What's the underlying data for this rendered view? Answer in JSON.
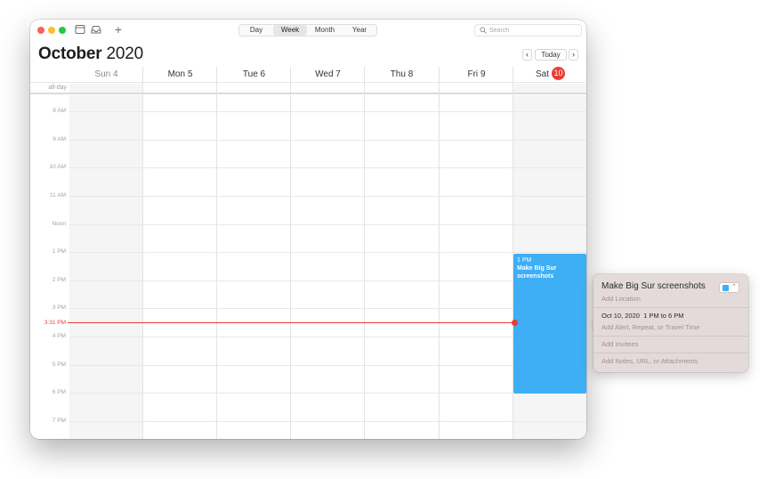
{
  "toolbar": {
    "views": [
      "Day",
      "Week",
      "Month",
      "Year"
    ],
    "selected_view": "Week",
    "search_placeholder": "Search"
  },
  "header": {
    "month": "October",
    "year": "2020",
    "today_label": "Today",
    "prev_label": "‹",
    "next_label": "›"
  },
  "days": [
    {
      "name": "Sun",
      "date": "4"
    },
    {
      "name": "Mon",
      "date": "5"
    },
    {
      "name": "Tue",
      "date": "6"
    },
    {
      "name": "Wed",
      "date": "7"
    },
    {
      "name": "Thu",
      "date": "8"
    },
    {
      "name": "Fri",
      "date": "9"
    },
    {
      "name": "Sat",
      "date": "10"
    }
  ],
  "allday_label": "all-day",
  "time_labels": [
    "8 AM",
    "9 AM",
    "10 AM",
    "11 AM",
    "Noon",
    "1 PM",
    "2 PM",
    "3 PM",
    "4 PM",
    "5 PM",
    "6 PM",
    "7 PM"
  ],
  "current_time": "3:31 PM",
  "event": {
    "time": "1 PM",
    "title": "Make Big Sur screenshots",
    "color": "#3eaef5"
  },
  "popover": {
    "title": "Make Big Sur screenshots",
    "location_placeholder": "Add Location",
    "date": "Oct 10, 2020",
    "time_range": "1 PM to 6 PM",
    "alert_placeholder": "Add Alert, Repeat, or Travel Time",
    "invitees_placeholder": "Add Invitees",
    "notes_placeholder": "Add Notes, URL, or Attachments",
    "calendar_color": "#3eaef5"
  },
  "colors": {
    "accent_red": "#ec3b32",
    "event_blue": "#3eaef5"
  }
}
